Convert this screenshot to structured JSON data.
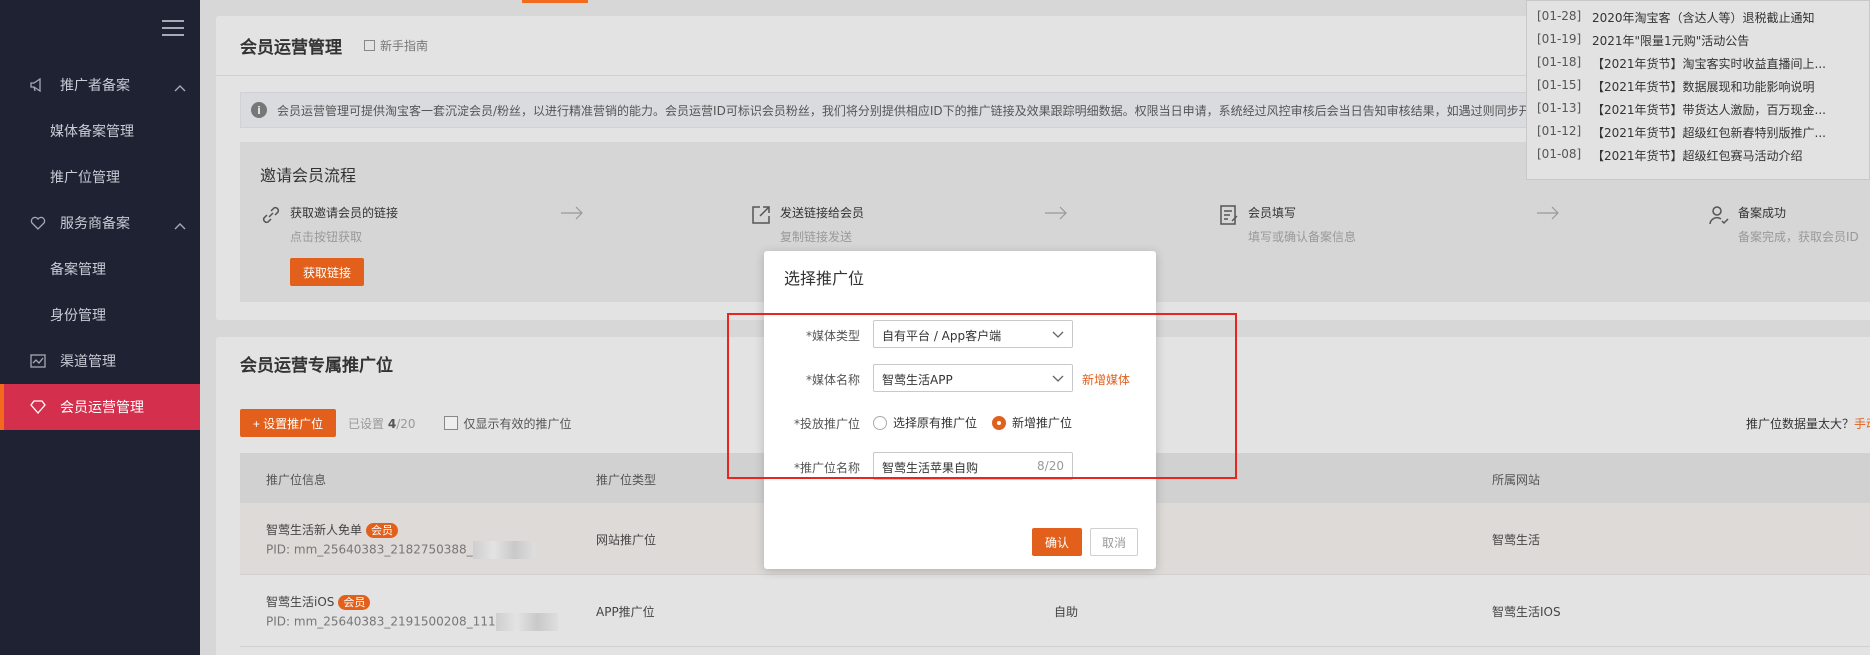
{
  "sidebar": {
    "groups": [
      {
        "label": "推广者备案",
        "items": [
          "媒体备案管理",
          "推广位管理"
        ]
      },
      {
        "label": "服务商备案",
        "items": [
          "备案管理",
          "身份管理"
        ]
      }
    ],
    "channel": "渠道管理",
    "member_ops": "会员运营管理"
  },
  "page": {
    "title": "会员运营管理",
    "guide": "新手指南",
    "notice": "会员运营管理可提供淘宝客一套沉淀会员/粉丝，以进行精准营销的能力。会员运营ID可标识会员粉丝，我们将分别提供相应ID下的推广链接及效果跟踪明细数据。权限当日申请，系统经过风控审核后会当日告知审核结果，如遇过则同步开",
    "flow_title": "邀请会员流程",
    "steps": [
      {
        "title": "获取邀请会员的链接",
        "desc": "点击按钮获取"
      },
      {
        "title": "发送链接给会员",
        "desc": "复制链接发送"
      },
      {
        "title": "会员填写",
        "desc": "填写或确认备案信息"
      },
      {
        "title": "备案成功",
        "desc": "备案完成，获取会员ID"
      }
    ],
    "get_link": "获取链接"
  },
  "positions": {
    "title": "会员运营专属推广位",
    "add_button": "+ 设置推广位",
    "set_prefix": "已设置",
    "set_count": "4",
    "set_total": "/20",
    "only_valid": "仅显示有效的推广位",
    "too_much": "推广位数据量太大？",
    "manual_record": "手动录",
    "columns": [
      "推广位信息",
      "推广位类型",
      "所属网站"
    ],
    "rows": [
      {
        "name": "智莺生活新人免单",
        "tag": "会员",
        "pid": "PID: mm_25640383_2182750388_",
        "type": "网站推广位",
        "mode": "",
        "site": "智莺生活"
      },
      {
        "name": "智莺生活iOS",
        "tag": "会员",
        "pid": "PID: mm_25640383_2191500208_111",
        "type": "APP推广位",
        "mode": "自助",
        "site": "智莺生活IOS"
      }
    ]
  },
  "announcements": [
    {
      "date": "[01-28]",
      "text": "2020年淘宝客（含达人等）退税截止通知"
    },
    {
      "date": "[01-19]",
      "text": "2021年\"限量1元购\"活动公告"
    },
    {
      "date": "[01-18]",
      "text": "【2021年货节】淘宝客实时收益直播间上..."
    },
    {
      "date": "[01-15]",
      "text": "【2021年货节】数据展现和功能影响说明"
    },
    {
      "date": "[01-13]",
      "text": "【2021年货节】带货达人激励，百万现金..."
    },
    {
      "date": "[01-12]",
      "text": "【2021年货节】超级红包新春特别版推广..."
    },
    {
      "date": "[01-08]",
      "text": "【2021年货节】超级红包赛马活动介绍"
    }
  ],
  "modal": {
    "title": "选择推广位",
    "media_type_label": "*媒体类型",
    "media_type_value": "自有平台 / App客户端",
    "media_name_label": "*媒体名称",
    "media_name_value": "智莺生活APP",
    "add_media": "新增媒体",
    "placement_label": "*投放推广位",
    "radio_existing": "选择原有推广位",
    "radio_new": "新增推广位",
    "position_name_label": "*推广位名称",
    "position_name_value": "智莺生活苹果自购",
    "position_name_count": "8/20",
    "ok": "确认",
    "cancel": "取消"
  },
  "colors": {
    "accent": "#e2601b",
    "sidebar": "#1f2233",
    "active": "#d4304e",
    "highlight": "#e8261f"
  }
}
